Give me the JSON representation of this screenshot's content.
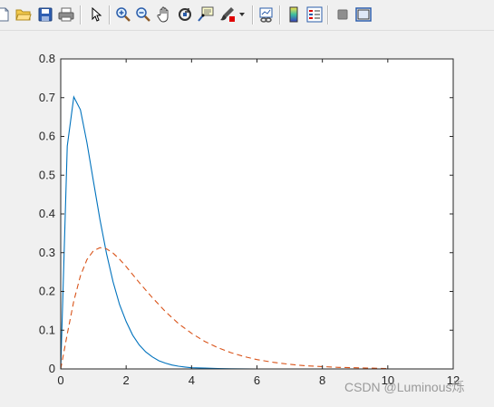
{
  "toolbar": {
    "items": [
      {
        "name": "new-figure",
        "icon": "new-file-icon"
      },
      {
        "name": "open-file",
        "icon": "folder-open-icon"
      },
      {
        "name": "save-figure",
        "icon": "save-icon"
      },
      {
        "name": "print-figure",
        "icon": "printer-icon"
      },
      {
        "name": "edit-plot",
        "icon": "pointer-arrow-icon"
      },
      {
        "name": "zoom-in",
        "icon": "zoom-in-icon"
      },
      {
        "name": "zoom-out",
        "icon": "zoom-out-icon"
      },
      {
        "name": "pan",
        "icon": "hand-icon"
      },
      {
        "name": "rotate-3d",
        "icon": "rotate-icon"
      },
      {
        "name": "data-cursor",
        "icon": "data-cursor-icon"
      },
      {
        "name": "brush",
        "icon": "brush-icon"
      },
      {
        "name": "link-plot",
        "icon": "link-plot-icon"
      },
      {
        "name": "insert-colorbar",
        "icon": "colorbar-icon"
      },
      {
        "name": "insert-legend",
        "icon": "legend-icon"
      },
      {
        "name": "hide-plot-tools",
        "icon": "hide-tools-icon"
      },
      {
        "name": "show-plot-tools",
        "icon": "show-tools-icon"
      }
    ]
  },
  "watermark": "CSDN @Luminous烁",
  "chart_data": {
    "type": "line",
    "title": "",
    "xlabel": "",
    "ylabel": "",
    "xlim": [
      0,
      12
    ],
    "ylim": [
      0,
      0.8
    ],
    "xticks": [
      "0",
      "2",
      "4",
      "6",
      "8",
      "10",
      "12"
    ],
    "yticks": [
      "0",
      "0.1",
      "0.2",
      "0.3",
      "0.4",
      "0.5",
      "0.6",
      "0.7",
      "0.8"
    ],
    "grid": false,
    "legend": "none",
    "series": [
      {
        "color": "#0072bd",
        "style": "solid",
        "x": [
          0,
          0.2,
          0.4,
          0.6,
          0.8,
          1.0,
          1.2,
          1.4,
          1.6,
          1.8,
          2.0,
          2.2,
          2.4,
          2.6,
          2.8,
          3.0,
          3.2,
          3.4,
          3.6,
          3.8,
          4.0,
          4.4,
          4.8,
          5.2,
          5.6,
          6.0,
          7.0,
          8.0,
          9.0,
          10.0
        ],
        "y": [
          0,
          0.575,
          0.702,
          0.669,
          0.584,
          0.484,
          0.385,
          0.298,
          0.225,
          0.166,
          0.122,
          0.087,
          0.062,
          0.044,
          0.031,
          0.021,
          0.015,
          0.01,
          0.007,
          0.005,
          0.003,
          0.002,
          0.001,
          0.0005,
          0.0002,
          0.0001,
          0,
          0,
          0,
          0
        ]
      },
      {
        "color": "#d95319",
        "style": "dashed",
        "x": [
          0,
          0.2,
          0.4,
          0.6,
          0.8,
          1.0,
          1.2,
          1.4,
          1.6,
          1.8,
          2.0,
          2.4,
          2.8,
          3.2,
          3.6,
          4.0,
          4.4,
          4.8,
          5.2,
          5.6,
          6.0,
          6.5,
          7.0,
          7.5,
          8.0,
          8.5,
          9.0,
          9.5,
          10.0
        ],
        "y": [
          0,
          0.09,
          0.175,
          0.24,
          0.282,
          0.305,
          0.313,
          0.31,
          0.299,
          0.283,
          0.264,
          0.223,
          0.184,
          0.148,
          0.117,
          0.092,
          0.071,
          0.055,
          0.042,
          0.032,
          0.024,
          0.017,
          0.012,
          0.008,
          0.006,
          0.004,
          0.003,
          0.002,
          0.001
        ]
      }
    ]
  }
}
